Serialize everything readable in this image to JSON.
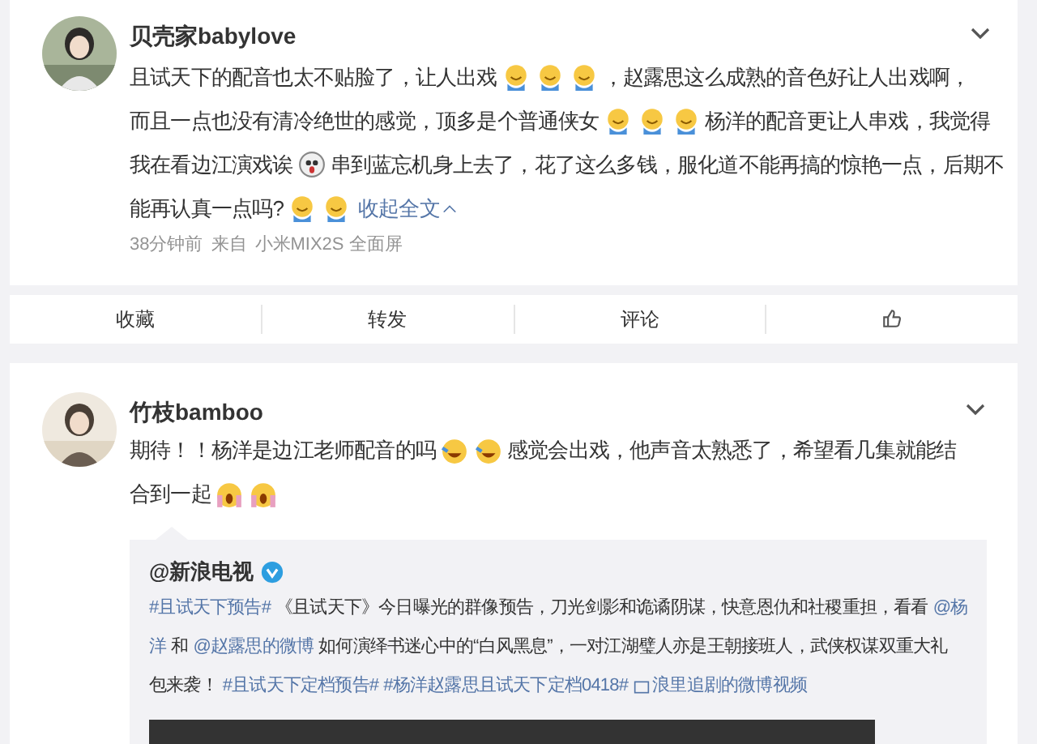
{
  "posts": [
    {
      "user": "贝壳家babylove",
      "lines": [
        [
          {
            "kind": "text",
            "text": "且试天下的配音也太不贴脸了，让人出戏"
          },
          {
            "kind": "grin"
          },
          {
            "kind": "grin"
          },
          {
            "kind": "grin"
          },
          {
            "kind": "text",
            "text": "，赵露思这么成熟的音色好让人出戏啊，"
          }
        ],
        [
          {
            "kind": "text",
            "text": "而且一点也没有清冷绝世的感觉，顶多是个普通侠女"
          },
          {
            "kind": "grin"
          },
          {
            "kind": "grin"
          },
          {
            "kind": "grin"
          },
          {
            "kind": "text",
            "text": "杨洋的配音更让人串戏，我觉得"
          }
        ],
        [
          {
            "kind": "text",
            "text": "我在看边江演戏诶"
          },
          {
            "kind": "shock"
          },
          {
            "kind": "text",
            "text": "串到蓝忘机身上去了，花了这么多钱，服化道不能再搞的惊艳一点，后期不"
          }
        ],
        [
          {
            "kind": "text",
            "text": "能再认真一点吗?"
          },
          {
            "kind": "grin"
          },
          {
            "kind": "grin"
          },
          {
            "kind": "collapse",
            "text": "收起全文"
          }
        ]
      ],
      "time": "38分钟前",
      "source_prefix": "来自",
      "device": "小米MIX2S 全面屏",
      "actions": [
        "收藏",
        "转发",
        "评论"
      ]
    },
    {
      "user": "竹枝bamboo",
      "lines": [
        [
          {
            "kind": "text",
            "text": "期待！！杨洋是边江老师配音的吗"
          },
          {
            "kind": "laugh"
          },
          {
            "kind": "laugh"
          },
          {
            "kind": "text",
            "text": "感觉会出戏，他声音太熟悉了，希望看几集就能结"
          }
        ],
        [
          {
            "kind": "text",
            "text": "合到一起"
          },
          {
            "kind": "scream"
          },
          {
            "kind": "scream"
          }
        ]
      ],
      "repost": {
        "author": "@新浪电视",
        "verified": true,
        "lines": [
          [
            {
              "kind": "link",
              "text": "#且试天下预告#"
            },
            {
              "kind": "text",
              "text": "《且试天下》今日曝光的群像预告，刀光剑影和诡谲阴谋，快意恩仇和社稷重担，看看"
            },
            {
              "kind": "link",
              "text": "@杨"
            }
          ],
          [
            {
              "kind": "link",
              "text": "洋"
            },
            {
              "kind": "text",
              "text": "和"
            },
            {
              "kind": "link",
              "text": "@赵露思的微博"
            },
            {
              "kind": "text",
              "text": "如何演绎书迷心中的“白风黑息”，一对江湖璧人亦是王朝接班人，武侠权谋双重大礼"
            }
          ],
          [
            {
              "kind": "text",
              "text": "包来袭！"
            },
            {
              "kind": "link",
              "text": "#且试天下定档预告#"
            },
            {
              "kind": "link",
              "text": "#杨洋赵露思且试天下定档0418#"
            },
            {
              "kind": "video-link",
              "text": "浪里追剧的微博视频"
            }
          ]
        ]
      }
    }
  ]
}
